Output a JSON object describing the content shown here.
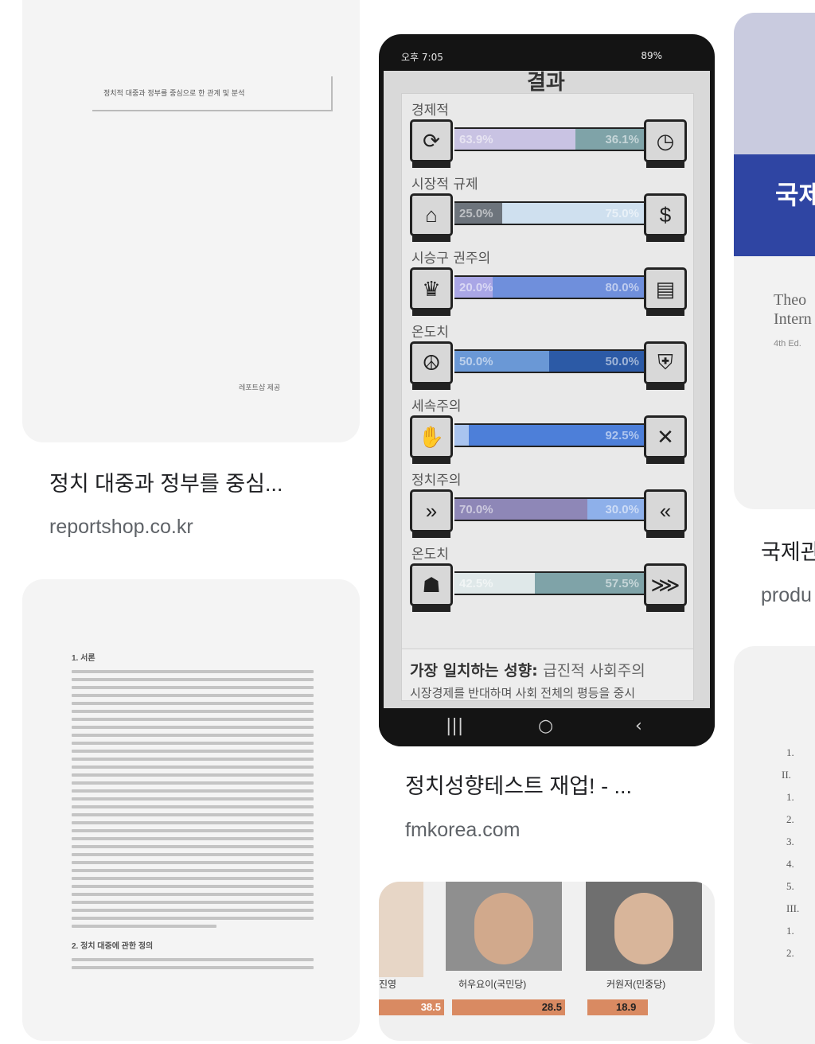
{
  "results": [
    {
      "caption": "정치 대중과 정부를 중심...",
      "source": "reportshop.co.kr",
      "doc_header": "정치적 대중과 정부를 중심으로 한 관계 및 분석",
      "doc_footer": "레포트샵 제공"
    },
    {
      "doc_section_1": "1. 서론",
      "doc_section_2": "2. 정치 대중에 관한 정의"
    },
    {
      "caption": "정치성향테스트 재업! - ...",
      "source": "fmkorea.com",
      "phone": {
        "status_left": "오후 7:05",
        "status_right": "89%",
        "screen_title": "결과",
        "axes": [
          {
            "label": "경제적",
            "left_icon": "refresh-icon",
            "right_icon": "clock-icon",
            "left_value": 63.9,
            "right_value": 36.1,
            "left_text": "63.9%",
            "right_text": "36.1%",
            "left_color": "#c9c3e3",
            "right_color": "#7fa3a8"
          },
          {
            "label": "시장적 규제",
            "left_icon": "government-icon",
            "right_icon": "dollar-icon",
            "left_value": 25.0,
            "right_value": 75.0,
            "left_text": "25.0%",
            "right_text": "75.0%",
            "left_color": "#6d747c",
            "right_color": "#cfe0ef"
          },
          {
            "label": "시승구 권주의",
            "left_icon": "crown-icon",
            "right_icon": "ballot-icon",
            "left_value": 20.0,
            "right_value": 80.0,
            "left_text": "20.0%",
            "right_text": "80.0%",
            "left_color": "#a9a6e6",
            "right_color": "#6f8fdc"
          },
          {
            "label": "온도치",
            "left_icon": "peace-icon",
            "right_icon": "military-icon",
            "left_value": 50.0,
            "right_value": 50.0,
            "left_text": "50.0%",
            "right_text": "50.0%",
            "left_color": "#6a98d6",
            "right_color": "#2c5aa6"
          },
          {
            "label": "세속주의",
            "left_icon": "hands-icon",
            "right_icon": "cross-icon",
            "left_value": 7.5,
            "right_value": 92.5,
            "left_text": "",
            "right_text": "92.5%",
            "left_color": "#a9c4ef",
            "right_color": "#4d7fd9"
          },
          {
            "label": "정치주의",
            "left_icon": "forward-chevrons-icon",
            "right_icon": "back-chevrons-icon",
            "left_value": 70.0,
            "right_value": 30.0,
            "left_text": "70.0%",
            "right_text": "30.0%",
            "left_color": "#8e87b7",
            "right_color": "#8eb0ea"
          },
          {
            "label": "온도치",
            "left_icon": "person-icon",
            "right_icon": "crowd-icon",
            "left_value": 42.5,
            "right_value": 57.5,
            "left_text": "42.5%",
            "right_text": "57.5%",
            "left_color": "#dfe8e9",
            "right_color": "#7fa3a8"
          }
        ],
        "match_title": "가장 일치하는 성향:",
        "match_value": "급진적 사회주의",
        "match_sub": "시장경제를 반대하며 사회 전체의 평등을 중시"
      }
    },
    {
      "labels": [
        "진영",
        "허우요이(국민당)",
        "커원저(민중당)"
      ],
      "values": [
        "38.5",
        "28.5",
        "18.9"
      ]
    },
    {
      "caption": "국제관계",
      "source": "produ",
      "book_title": "국제",
      "book_sub_1": "Theo",
      "book_sub_2": "Intern",
      "book_edition": "4th Ed."
    },
    {
      "toc_items": [
        "1.",
        "II.",
        "1.",
        "2.",
        "3.",
        "4.",
        "5.",
        "III.",
        "1.",
        "2."
      ]
    }
  ]
}
